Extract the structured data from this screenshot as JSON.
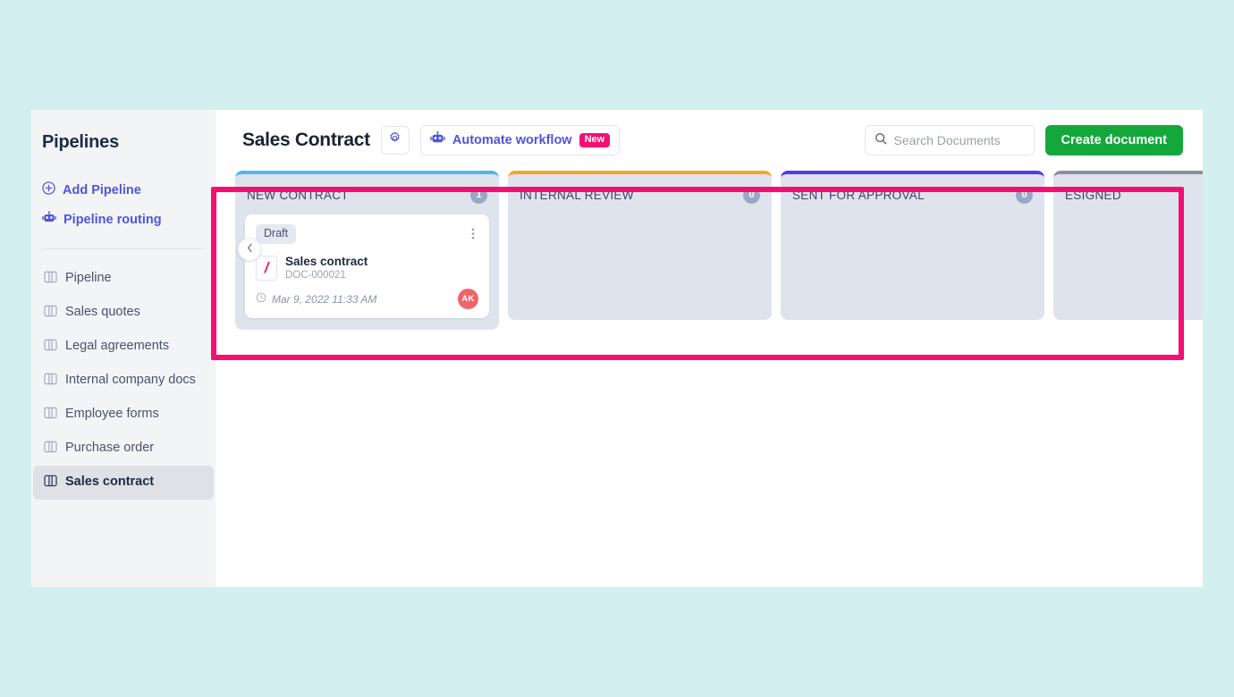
{
  "sidebar": {
    "title": "Pipelines",
    "actions": [
      {
        "label": "Add Pipeline",
        "icon": "plus-circle-icon"
      },
      {
        "label": "Pipeline routing",
        "icon": "robot-icon"
      }
    ],
    "items": [
      {
        "label": "Pipeline",
        "active": false
      },
      {
        "label": "Sales quotes",
        "active": false
      },
      {
        "label": "Legal agreements",
        "active": false
      },
      {
        "label": "Internal company docs",
        "active": false
      },
      {
        "label": "Employee forms",
        "active": false
      },
      {
        "label": "Purchase order",
        "active": false
      },
      {
        "label": "Sales contract",
        "active": true
      }
    ]
  },
  "topbar": {
    "collapse_icon": "chevron-left-icon",
    "title": "Sales Contract",
    "settings_icon": "gear-icon",
    "automate": {
      "label": "Automate workflow",
      "icon": "robot-icon",
      "badge": "New"
    },
    "search": {
      "placeholder": "Search Documents",
      "value": "",
      "icon": "search-icon"
    },
    "create_label": "Create document"
  },
  "board": {
    "columns": [
      {
        "title": "NEW CONTRACT",
        "count": "1",
        "accent": "#4fb8e8",
        "cards": [
          {
            "status": "Draft",
            "name": "Sales contract",
            "id": "DOC-000021",
            "date": "Mar 9, 2022 11:33 AM",
            "avatar": "AK",
            "avatar_color": "#f1636b",
            "menu_icon": "more-vertical-icon",
            "doc_icon": "document-icon",
            "clock_icon": "clock-icon"
          }
        ]
      },
      {
        "title": "INTERNAL REVIEW",
        "count": "0",
        "accent": "#f5a623",
        "cards": []
      },
      {
        "title": "SENT FOR APPROVAL",
        "count": "0",
        "accent": "#4f3fe0",
        "cards": []
      },
      {
        "title": "ESIGNED",
        "count": "",
        "accent": "#8a8f9c",
        "cards": []
      }
    ]
  },
  "colors": {
    "page_background": "#d4eff0",
    "highlight": "#f50f72",
    "accent_blue": "#4f56d8",
    "create_green": "#14a83c"
  }
}
